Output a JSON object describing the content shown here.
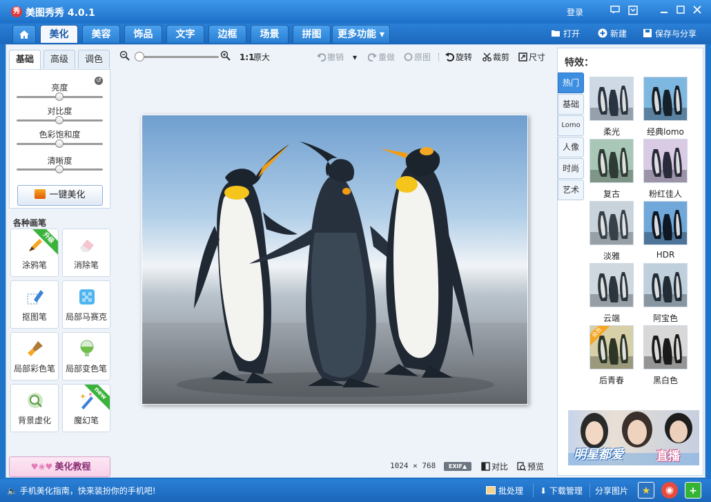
{
  "window": {
    "logo_text": "秀",
    "title": "美图秀秀 4.0.1",
    "login": "登录"
  },
  "tabs": [
    "美化",
    "美容",
    "饰品",
    "文字",
    "边框",
    "场景",
    "拼图",
    "更多功能 ▾"
  ],
  "menu_right": {
    "open": "打开",
    "new": "新建",
    "save": "保存与分享"
  },
  "left": {
    "sub_tabs": [
      "基础",
      "高级",
      "调色"
    ],
    "sliders": [
      {
        "label": "亮度",
        "value": 0.5
      },
      {
        "label": "对比度",
        "value": 0.5
      },
      {
        "label": "色彩饱和度",
        "value": 0.5
      },
      {
        "label": "清晰度",
        "value": 0.5
      }
    ],
    "one_click": "一键美化",
    "brushes_title": "各种画笔",
    "brushes": [
      {
        "label": "涂鸦笔",
        "badge": "升级"
      },
      {
        "label": "消除笔",
        "badge": ""
      },
      {
        "label": "抠图笔",
        "badge": ""
      },
      {
        "label": "局部马赛克",
        "badge": ""
      },
      {
        "label": "局部彩色笔",
        "badge": ""
      },
      {
        "label": "局部变色笔",
        "badge": ""
      },
      {
        "label": "背景虚化",
        "badge": ""
      },
      {
        "label": "魔幻笔",
        "badge": "new"
      }
    ],
    "tutorial": "美化教程"
  },
  "toolbar": {
    "ratio_label": "1:1",
    "original_size": "原大",
    "undo": "撤销",
    "redo": "重做",
    "original": "原图",
    "rotate": "旋转",
    "crop": "裁剪",
    "resize": "尺寸"
  },
  "status": {
    "width": "1024",
    "times": "×",
    "height": "768",
    "exif": "EXIF▲",
    "compare": "对比",
    "preview": "预览"
  },
  "right": {
    "title": "特效：",
    "categories": [
      "热门",
      "基础",
      "Lomo",
      "人像",
      "时尚",
      "艺术"
    ],
    "effects": [
      {
        "label": "柔光",
        "badge": ""
      },
      {
        "label": "经典lomo",
        "badge": ""
      },
      {
        "label": "复古",
        "badge": ""
      },
      {
        "label": "粉红佳人",
        "badge": ""
      },
      {
        "label": "淡雅",
        "badge": ""
      },
      {
        "label": "HDR",
        "badge": ""
      },
      {
        "label": "云端",
        "badge": ""
      },
      {
        "label": "阿宝色",
        "badge": ""
      },
      {
        "label": "后青春",
        "badge": "会员"
      },
      {
        "label": "黑白色",
        "badge": ""
      }
    ],
    "ad_text": "明星都爱",
    "ad_live": "直播"
  },
  "bottom": {
    "tip": "手机美化指南，快来装扮你的手机吧!",
    "batch": "批处理",
    "download": "下载管理",
    "share": "分享图片"
  },
  "colors": {
    "primary": "#1f73c9",
    "accent_orange": "#f6a623",
    "ribbon_green": "#3bb33b"
  }
}
